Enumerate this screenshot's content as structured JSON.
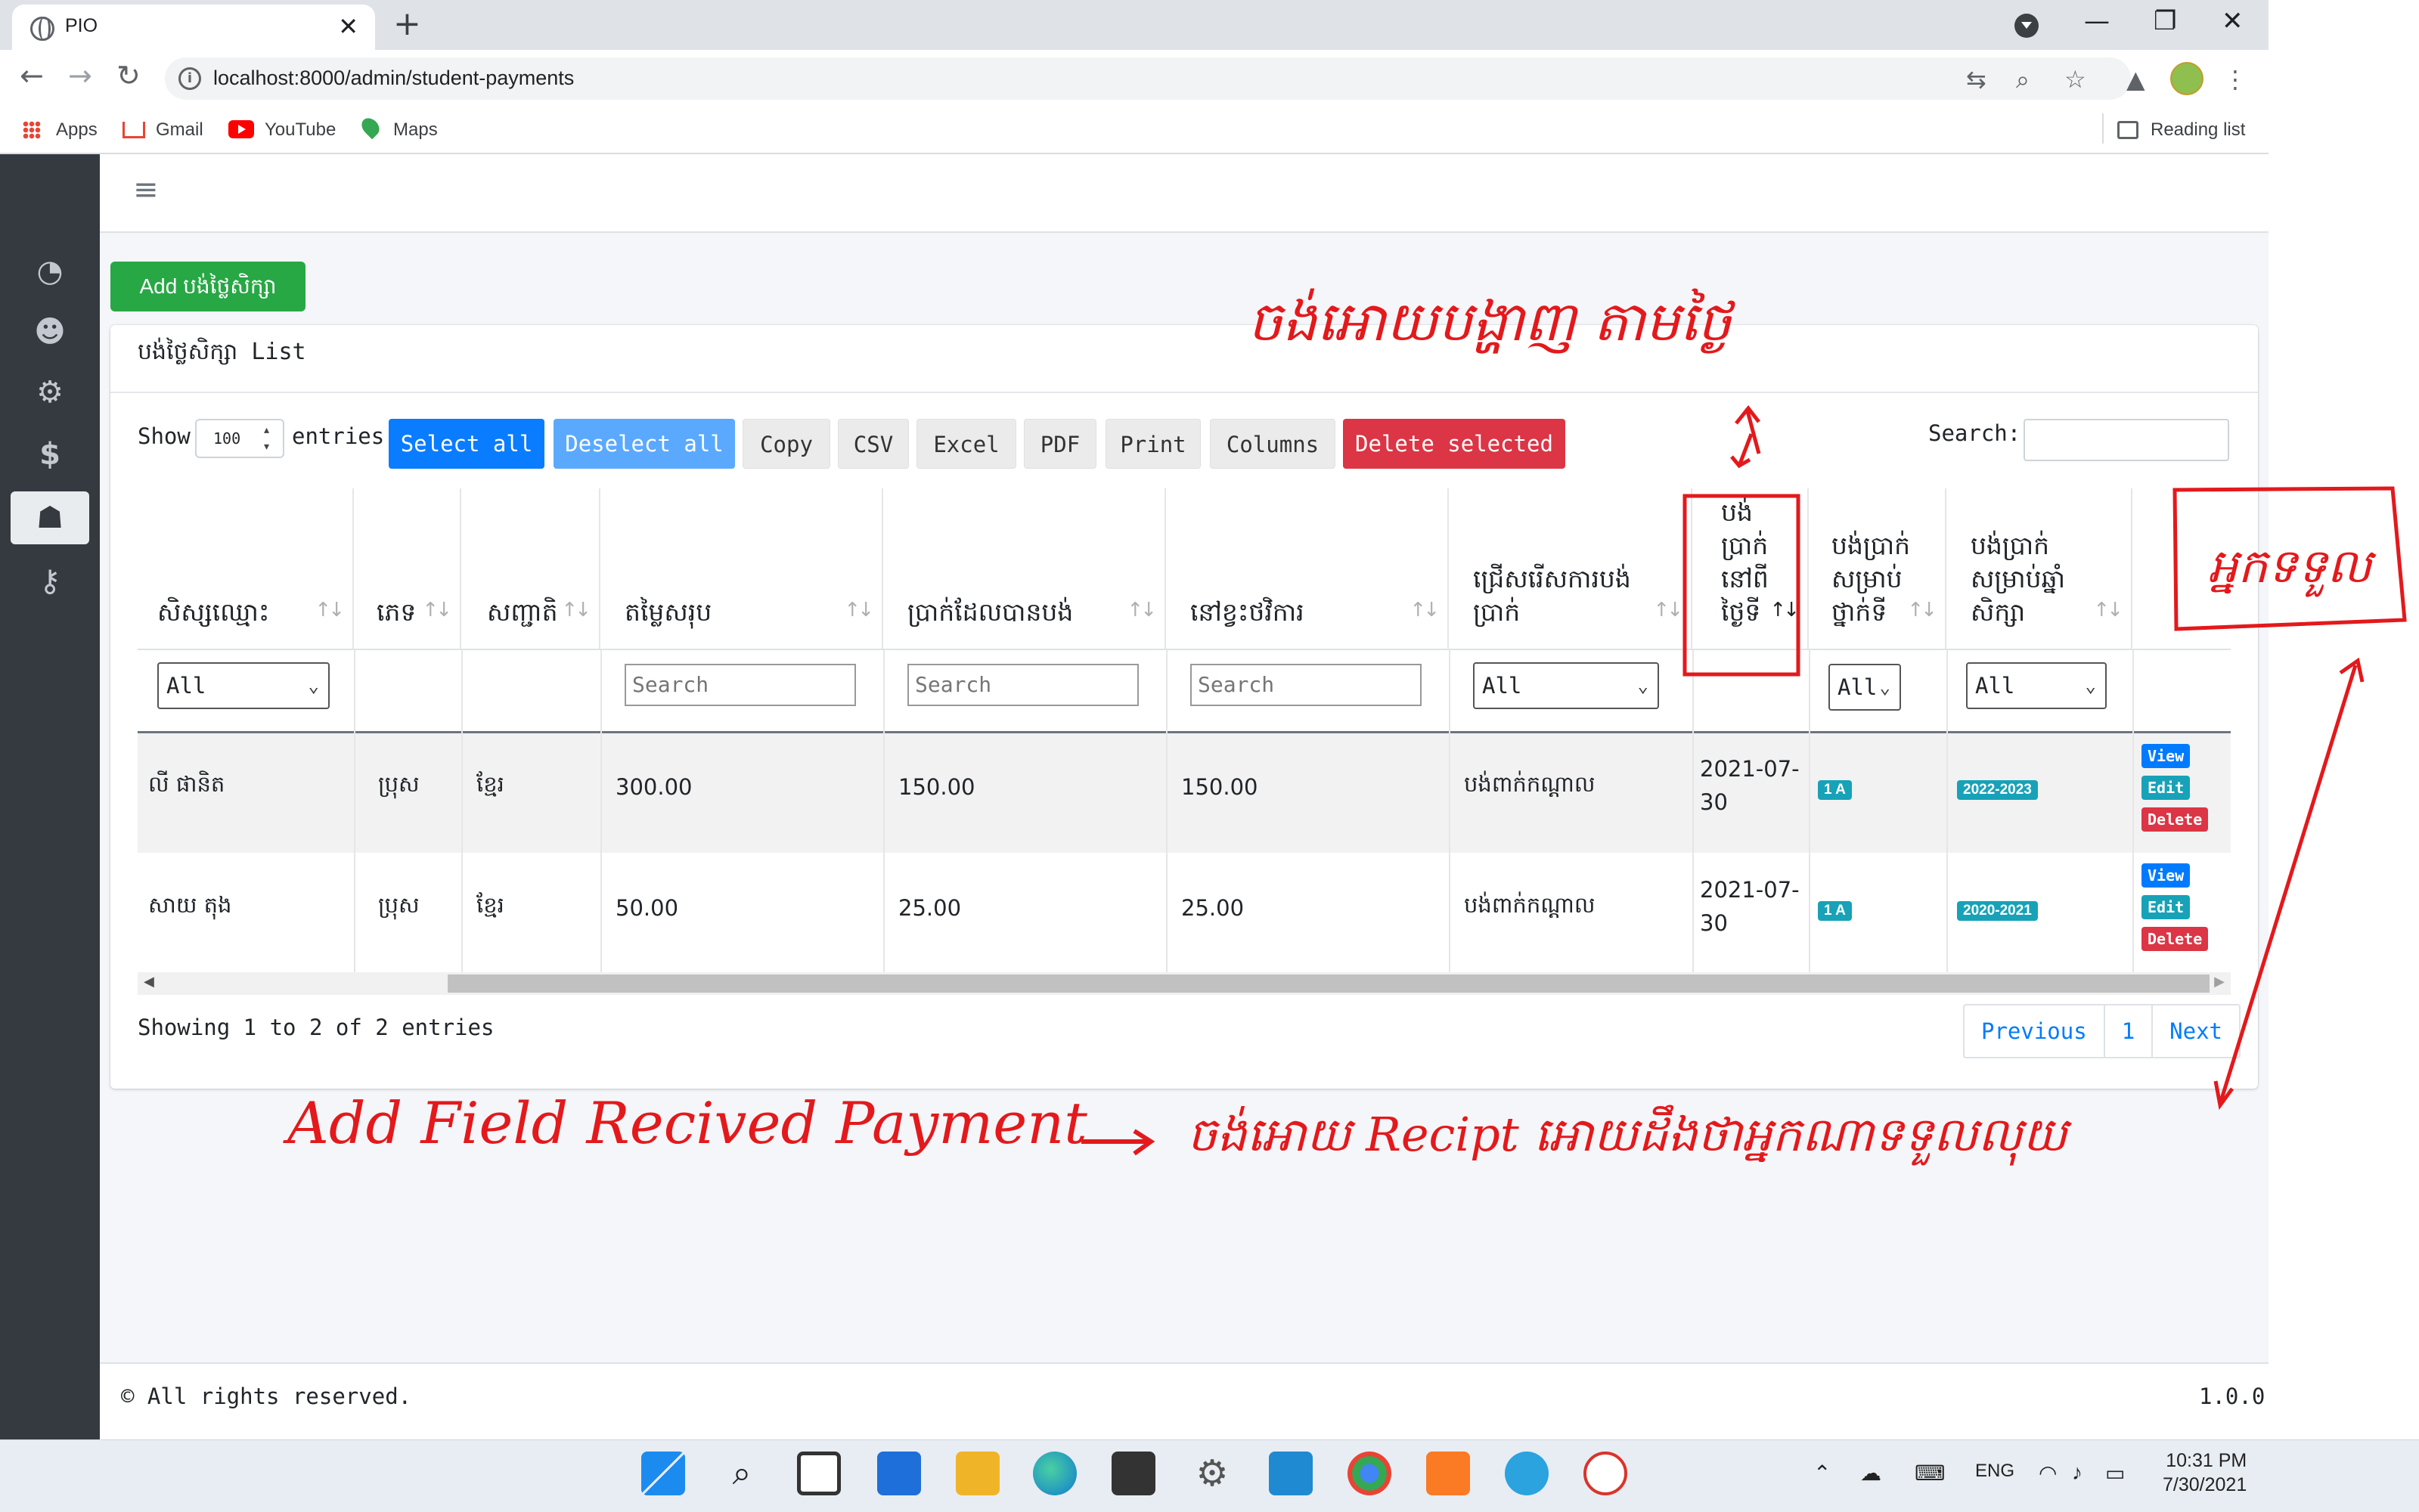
{
  "browser": {
    "tab_title": "PIO",
    "url": "localhost:8000/admin/student-payments",
    "bookmarks": [
      "Apps",
      "Gmail",
      "YouTube",
      "Maps"
    ],
    "reading_list": "Reading list"
  },
  "page": {
    "add_button": "Add បង់ថ្លៃសិក្សា",
    "card_title": "បង់ថ្លៃសិក្សា List",
    "show_label": "Show",
    "page_length": "100",
    "entries_label": "entries",
    "search_label": "Search:",
    "buttons": {
      "select_all": "Select all",
      "deselect_all": "Deselect all",
      "copy": "Copy",
      "csv": "CSV",
      "excel": "Excel",
      "pdf": "PDF",
      "print": "Print",
      "columns": "Columns",
      "delete_selected": "Delete selected"
    },
    "columns": [
      "សិស្សឈ្មោះ",
      "ភេទ",
      "សញ្ជាតិ",
      "តម្លៃសរុប",
      "ប្រាក់ដែលបានបង់",
      "នៅខ្វះថវិការ",
      "ជ្រើសរើសការបង់ប្រាក់",
      "បង់ប្រាក់នៅពីថ្ងៃទី",
      "បង់ប្រាក់សម្រាប់ថ្នាក់ទី",
      "បង់ប្រាក់សម្រាប់ឆ្នាំសិក្សា"
    ],
    "filters": {
      "all": "All",
      "search_placeholder": "Search"
    },
    "rows": [
      {
        "name": "លី ផានិត",
        "gender": "ប្រុស",
        "nationality": "ខ្មែរ",
        "total": "300.00",
        "paid": "150.00",
        "remaining": "150.00",
        "payment_type": "បង់ពាក់កណ្ដាល",
        "date_line1": "2021-07-",
        "date_line2": "30",
        "class": "1 A",
        "year": "2022-2023"
      },
      {
        "name": "សាយ តុង",
        "gender": "ប្រុស",
        "nationality": "ខ្មែរ",
        "total": "50.00",
        "paid": "25.00",
        "remaining": "25.00",
        "payment_type": "បង់ពាក់កណ្ដាល",
        "date_line1": "2021-07-",
        "date_line2": "30",
        "class": "1 A",
        "year": "2020-2021"
      }
    ],
    "row_actions": {
      "view": "View",
      "edit": "Edit",
      "delete": "Delete"
    },
    "info": "Showing 1 to 2 of 2 entries",
    "pagination": {
      "previous": "Previous",
      "page": "1",
      "next": "Next"
    },
    "footer_copy": "© All rights reserved.",
    "footer_version": "1.0.0"
  },
  "annotations": {
    "note_top": "ចង់អោយបង្ហាញ តាមថ្ងៃ",
    "note_right": "អ្នកទទួល",
    "note_bottom_left": "Add Field Recived Payment",
    "note_bottom_right": "ចង់អោយ Recipt អោយដឹងថាអ្នកណាទទួលលុយ"
  },
  "taskbar": {
    "time": "10:31 PM",
    "date": "7/30/2021",
    "lang": "ENG"
  },
  "colors": {
    "sidebar": "#343a40",
    "success": "#28a745",
    "primary": "#0a7cff",
    "danger": "#dc3545",
    "info": "#17a2b8",
    "annotation": "#e3191c"
  }
}
